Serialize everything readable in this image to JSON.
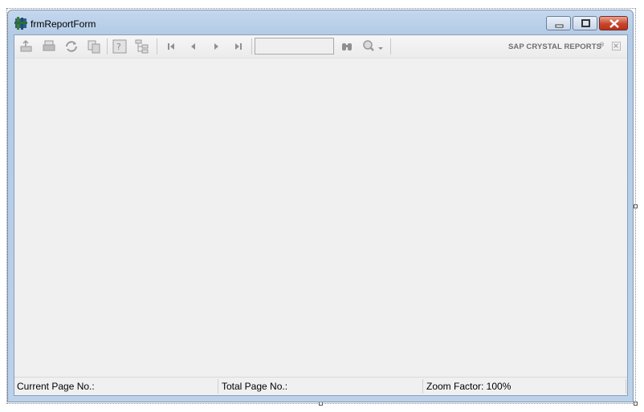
{
  "window": {
    "title": "frmReportForm",
    "controls": {
      "minimize": "minimize-icon",
      "maximize": "maximize-icon",
      "close": "close-icon"
    }
  },
  "toolbar": {
    "buttons": [
      {
        "name": "export-icon"
      },
      {
        "name": "print-icon"
      },
      {
        "name": "refresh-icon"
      },
      {
        "name": "copy-icon"
      },
      {
        "name": "help-icon"
      },
      {
        "name": "group-tree-icon"
      },
      {
        "name": "first-page-icon"
      },
      {
        "name": "previous-page-icon"
      },
      {
        "name": "next-page-icon"
      },
      {
        "name": "last-page-icon"
      },
      {
        "name": "find-icon"
      },
      {
        "name": "zoom-icon"
      }
    ],
    "goto_page_value": "",
    "brand": "SAP CRYSTAL REPORTS",
    "brand_mark": "®"
  },
  "statusbar": {
    "current_page": "Current Page No.:",
    "total_page": "Total Page No.:",
    "zoom": "Zoom Factor: 100%"
  },
  "colors": {
    "titlebar": "#bcd1ea",
    "client_bg": "#f0f0f0",
    "close_button": "#c7452c",
    "toolbar_icon": "#9a9a9a"
  }
}
